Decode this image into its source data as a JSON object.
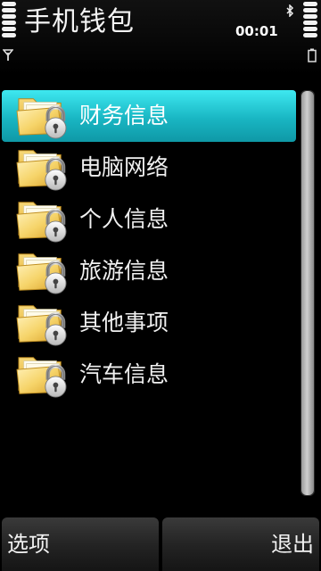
{
  "status_bar": {
    "app_title": "手机钱包",
    "clock": "00:01",
    "signal_icon": "signal-bars-icon",
    "battery_icon": "battery-bars-icon",
    "bluetooth_icon": "bluetooth-icon"
  },
  "list": {
    "selected_index": 0,
    "items": [
      {
        "label": "财务信息",
        "icon": "locked-folder-icon"
      },
      {
        "label": "电脑网络",
        "icon": "locked-folder-icon"
      },
      {
        "label": "个人信息",
        "icon": "locked-folder-icon"
      },
      {
        "label": "旅游信息",
        "icon": "locked-folder-icon"
      },
      {
        "label": "其他事项",
        "icon": "locked-folder-icon"
      },
      {
        "label": "汽车信息",
        "icon": "locked-folder-icon"
      }
    ]
  },
  "softkeys": {
    "left_label": "选项",
    "right_label": "退出"
  },
  "colors": {
    "highlight": "#19b6c3",
    "background": "#000000",
    "folder": "#f2c640"
  }
}
